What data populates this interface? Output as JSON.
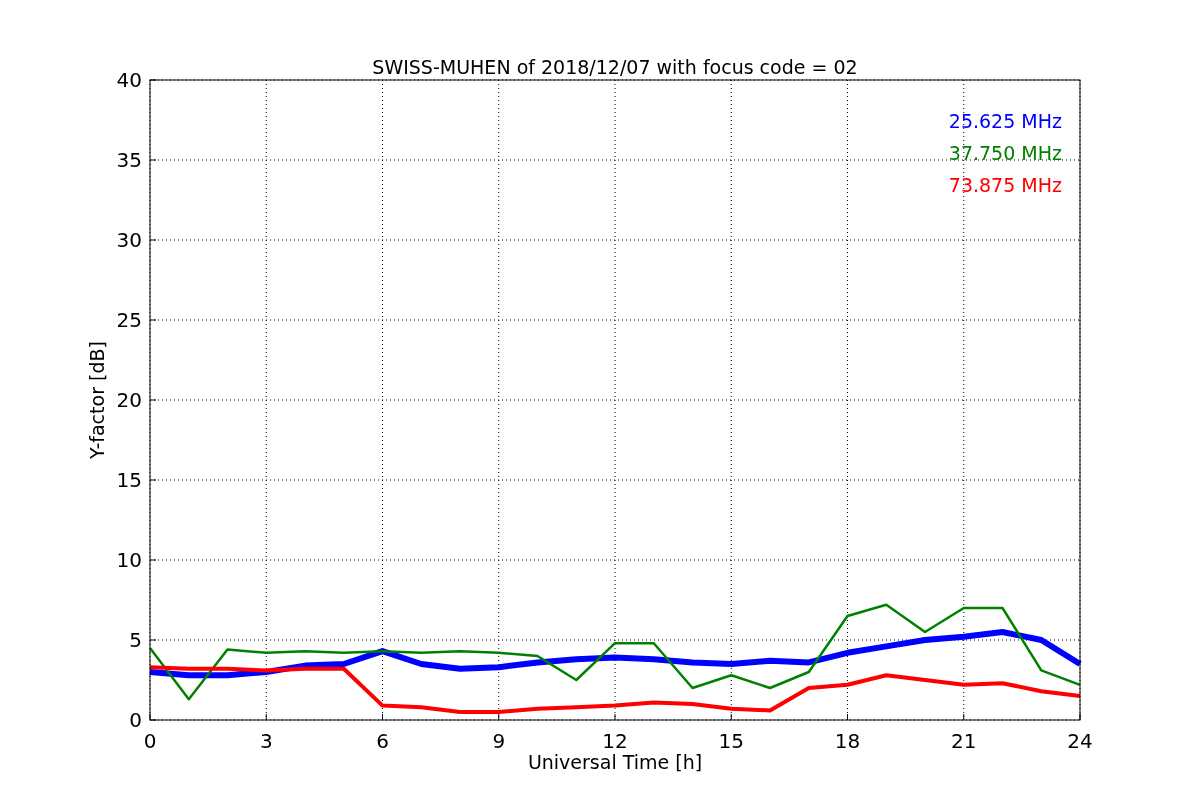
{
  "chart_data": {
    "type": "line",
    "title": "SWISS-MUHEN of 2018/12/07 with focus code = 02",
    "xlabel": "Universal Time [h]",
    "ylabel": "Y-factor [dB]",
    "x": [
      0,
      1,
      2,
      3,
      4,
      5,
      6,
      7,
      8,
      9,
      10,
      11,
      12,
      13,
      14,
      15,
      16,
      17,
      18,
      19,
      20,
      21,
      22,
      23,
      24
    ],
    "series": [
      {
        "name": "25.625 MHz",
        "color": "#0000ff",
        "values": [
          3,
          2.8,
          2.8,
          3,
          3.4,
          3.5,
          4.3,
          3.5,
          3.2,
          3.3,
          3.6,
          3.8,
          3.9,
          3.8,
          3.6,
          3.5,
          3.7,
          3.6,
          4.2,
          4.6,
          5,
          5.2,
          5.5,
          5,
          3.5
        ]
      },
      {
        "name": "37.750 MHz",
        "color": "#008000",
        "values": [
          4.5,
          1.3,
          4.4,
          4.2,
          4.3,
          4.2,
          4.3,
          4.2,
          4.3,
          4.2,
          4,
          2.5,
          4.8,
          4.8,
          2,
          2.8,
          2,
          3,
          6.5,
          7.2,
          5.5,
          7,
          7,
          3.1,
          2.2
        ]
      },
      {
        "name": "73.875 MHz",
        "color": "#ff0000",
        "values": [
          3.3,
          3.2,
          3.2,
          3.1,
          3.2,
          3.2,
          0.9,
          0.8,
          0.5,
          0.5,
          0.7,
          0.8,
          0.9,
          1.1,
          1,
          0.7,
          0.6,
          2,
          2.2,
          2.8,
          2.5,
          2.2,
          2.3,
          1.8,
          1.5
        ]
      }
    ],
    "xlim": [
      0,
      24
    ],
    "ylim": [
      0,
      40
    ],
    "xticks": [
      0,
      3,
      6,
      9,
      12,
      15,
      18,
      21,
      24
    ],
    "yticks": [
      0,
      5,
      10,
      15,
      20,
      25,
      30,
      35,
      40
    ],
    "grid": true
  }
}
